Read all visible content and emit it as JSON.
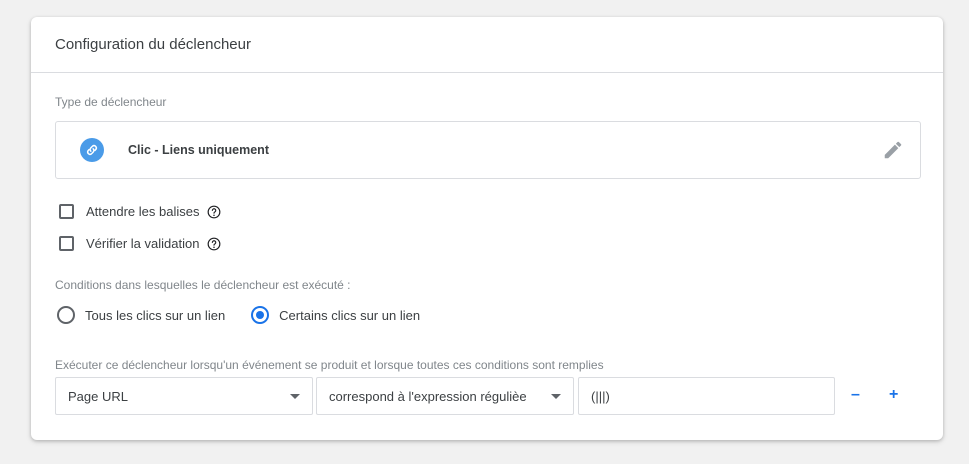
{
  "header": {
    "title": "Configuration du déclencheur"
  },
  "trigger_type": {
    "section_label": "Type de déclencheur",
    "name": "Clic - Liens uniquement",
    "icon": "link-icon",
    "icon_color": "#4a9be8"
  },
  "options": [
    {
      "label": "Attendre les balises",
      "checked": false
    },
    {
      "label": "Vérifier la validation",
      "checked": false
    }
  ],
  "conditions": {
    "section_label": "Conditions dans lesquelles le déclencheur est exécuté :",
    "radios": [
      {
        "label": "Tous les clics sur un lien",
        "selected": false
      },
      {
        "label": "Certains clics sur un lien",
        "selected": true
      }
    ]
  },
  "filter": {
    "section_label": "Exécuter ce déclencheur lorsqu'un événement se produit et lorsque toutes ces conditions sont remplies",
    "variable": "Page URL",
    "operator": "correspond à l'expression régulièe",
    "value": "(|||)",
    "remove_label": "–",
    "add_label": "+"
  },
  "colors": {
    "accent": "#1a73e8",
    "border": "#dadce0"
  }
}
